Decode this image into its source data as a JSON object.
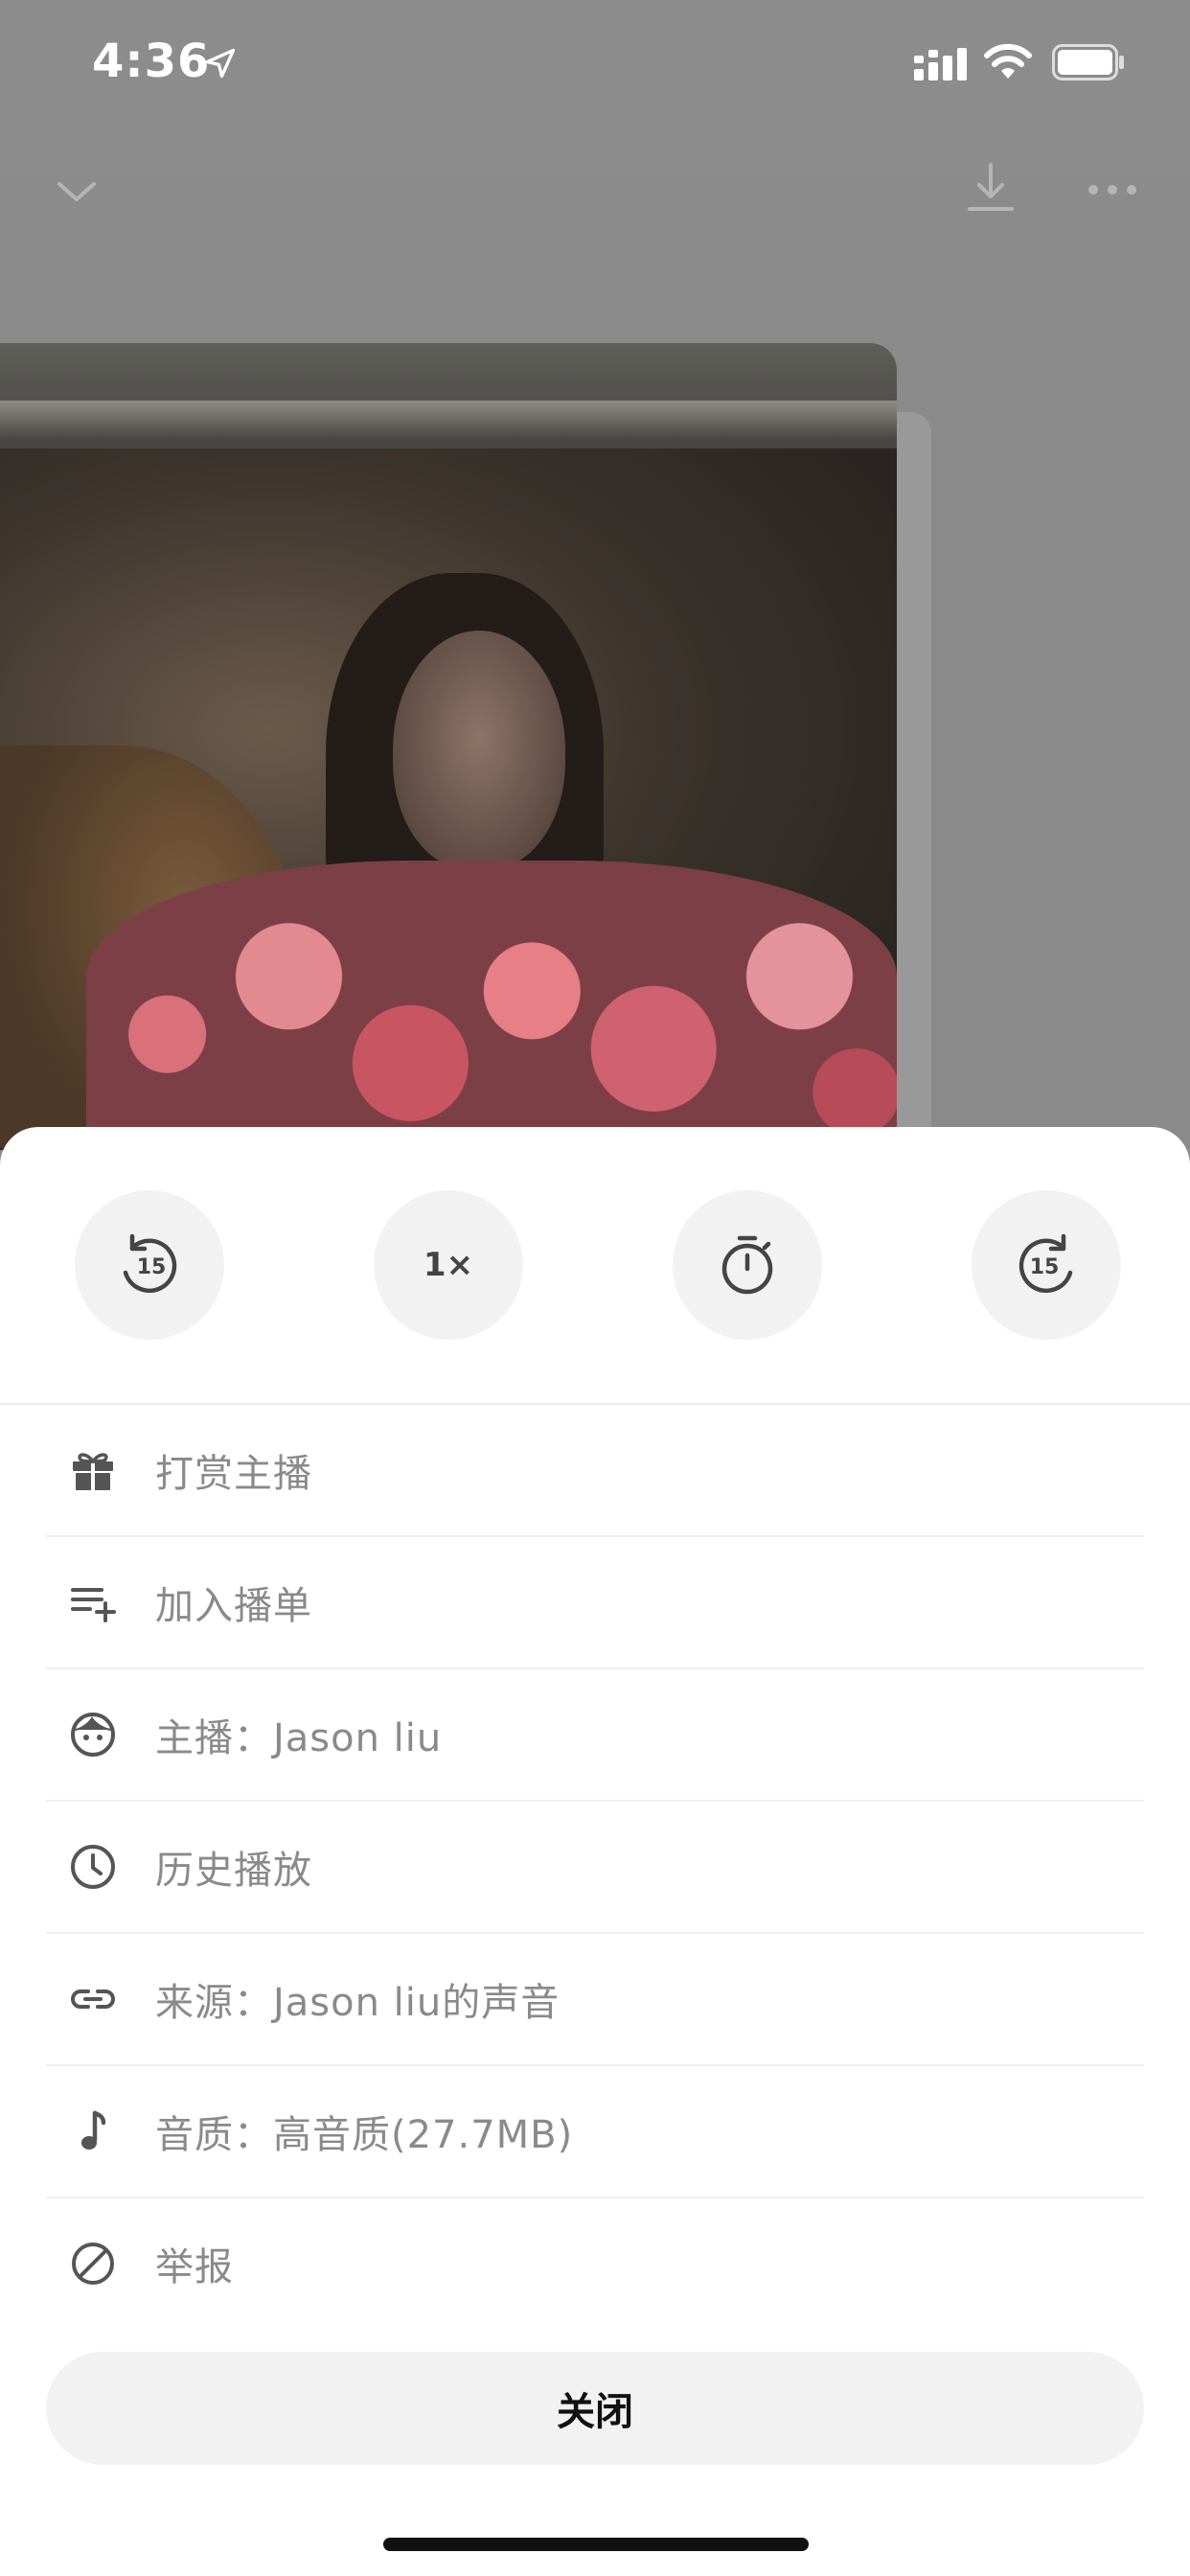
{
  "status_bar": {
    "time": "4:36"
  },
  "quick_actions": [
    {
      "name": "rewind-15",
      "label": "15"
    },
    {
      "name": "playback-speed",
      "label": "1×"
    },
    {
      "name": "sleep-timer",
      "label": ""
    },
    {
      "name": "forward-15",
      "label": "15"
    }
  ],
  "menu": {
    "items": [
      {
        "icon": "gift-icon",
        "label": "打赏主播"
      },
      {
        "icon": "add-to-playlist-icon",
        "label": "加入播单"
      },
      {
        "icon": "host-face-icon",
        "label": "主播：Jason  liu"
      },
      {
        "icon": "history-clock-icon",
        "label": "历史播放"
      },
      {
        "icon": "link-icon",
        "label": "来源：Jason  liu的声音"
      },
      {
        "icon": "music-note-icon",
        "label": "音质：高音质(27.7MB)"
      },
      {
        "icon": "report-ban-icon",
        "label": "举报"
      }
    ]
  },
  "close_label": "关闭",
  "colors": {
    "sheet": "#ffffff",
    "icon": "#555555",
    "label": "#8a8a8a",
    "button_bg": "#f2f2f2"
  }
}
